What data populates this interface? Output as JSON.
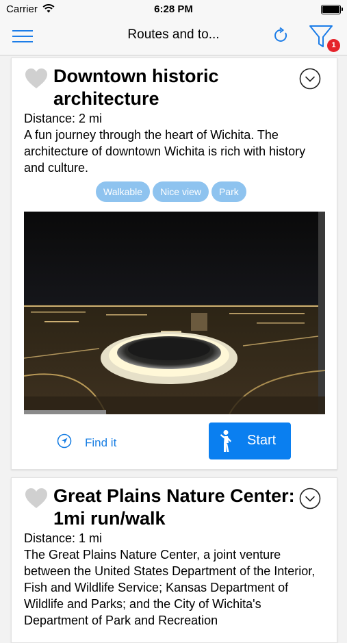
{
  "status_bar": {
    "carrier": "Carrier",
    "time": "6:28 PM"
  },
  "nav": {
    "title": "Routes and to...",
    "filter_badge": "1"
  },
  "routes": [
    {
      "title": "Downtown historic architecture",
      "distance": "Distance: 2 mi",
      "description": "A fun journey through the heart of Wichita. The architecture of downtown Wichita is rich with history and culture.",
      "tags": [
        "Walkable",
        "Nice view",
        "Park"
      ],
      "find_label": "Find it",
      "start_label": "Start"
    },
    {
      "title": "Great Plains Nature Center: 1mi run/walk",
      "distance": "Distance: 1 mi",
      "description": "The Great Plains Nature Center, a joint venture between the United States Department of the Interior, Fish and Wildlife Service; Kansas Department of Wildlife and Parks; and the City of Wichita's Department of Park and Recreation"
    }
  ],
  "icons": {
    "menu": "hamburger-menu-icon",
    "refresh": "refresh-icon",
    "filter": "funnel-filter-icon",
    "favorite": "heart-icon",
    "expand": "chevron-down-circle-icon",
    "location": "navigation-arrow-icon",
    "walker": "walking-person-icon"
  },
  "colors": {
    "accent": "#0a7ff0",
    "tag": "#8ec3ef",
    "badge": "#e5232b"
  }
}
